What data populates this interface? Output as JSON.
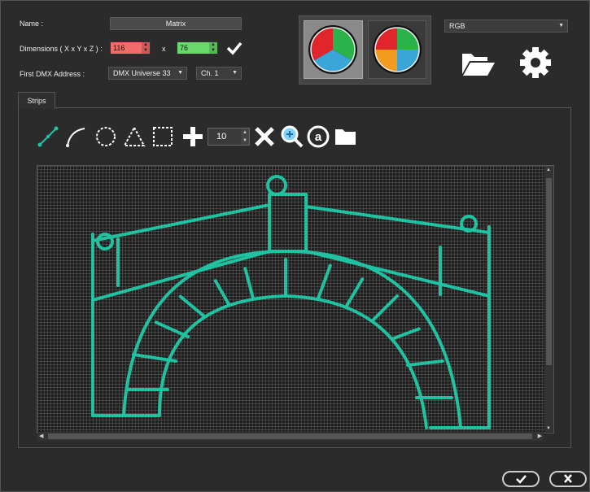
{
  "form": {
    "name_label": "Name :",
    "name_value": "Matrix",
    "dimensions_label": "Dimensions ( X x Y x Z ) :",
    "dim_x": "116",
    "dim_separator": "x",
    "dim_y": "76",
    "first_dmx_label": "First DMX Address :",
    "dmx_universe": "DMX Universe 33",
    "channel": "Ch. 1"
  },
  "color_mode": "RGB",
  "tabs": [
    {
      "label": "Strips"
    }
  ],
  "toolbar": {
    "step_value": "10",
    "icons": [
      "line-icon",
      "curve-icon",
      "circle-icon",
      "triangle-icon",
      "rectangle-icon",
      "plus-icon",
      "stepper",
      "delete-icon",
      "zoom-icon",
      "at-icon",
      "folder-icon"
    ]
  },
  "colors": {
    "strip": "#1fc3a1",
    "dim_x_bg": "#f26b6b",
    "dim_y_bg": "#6bd86b"
  }
}
